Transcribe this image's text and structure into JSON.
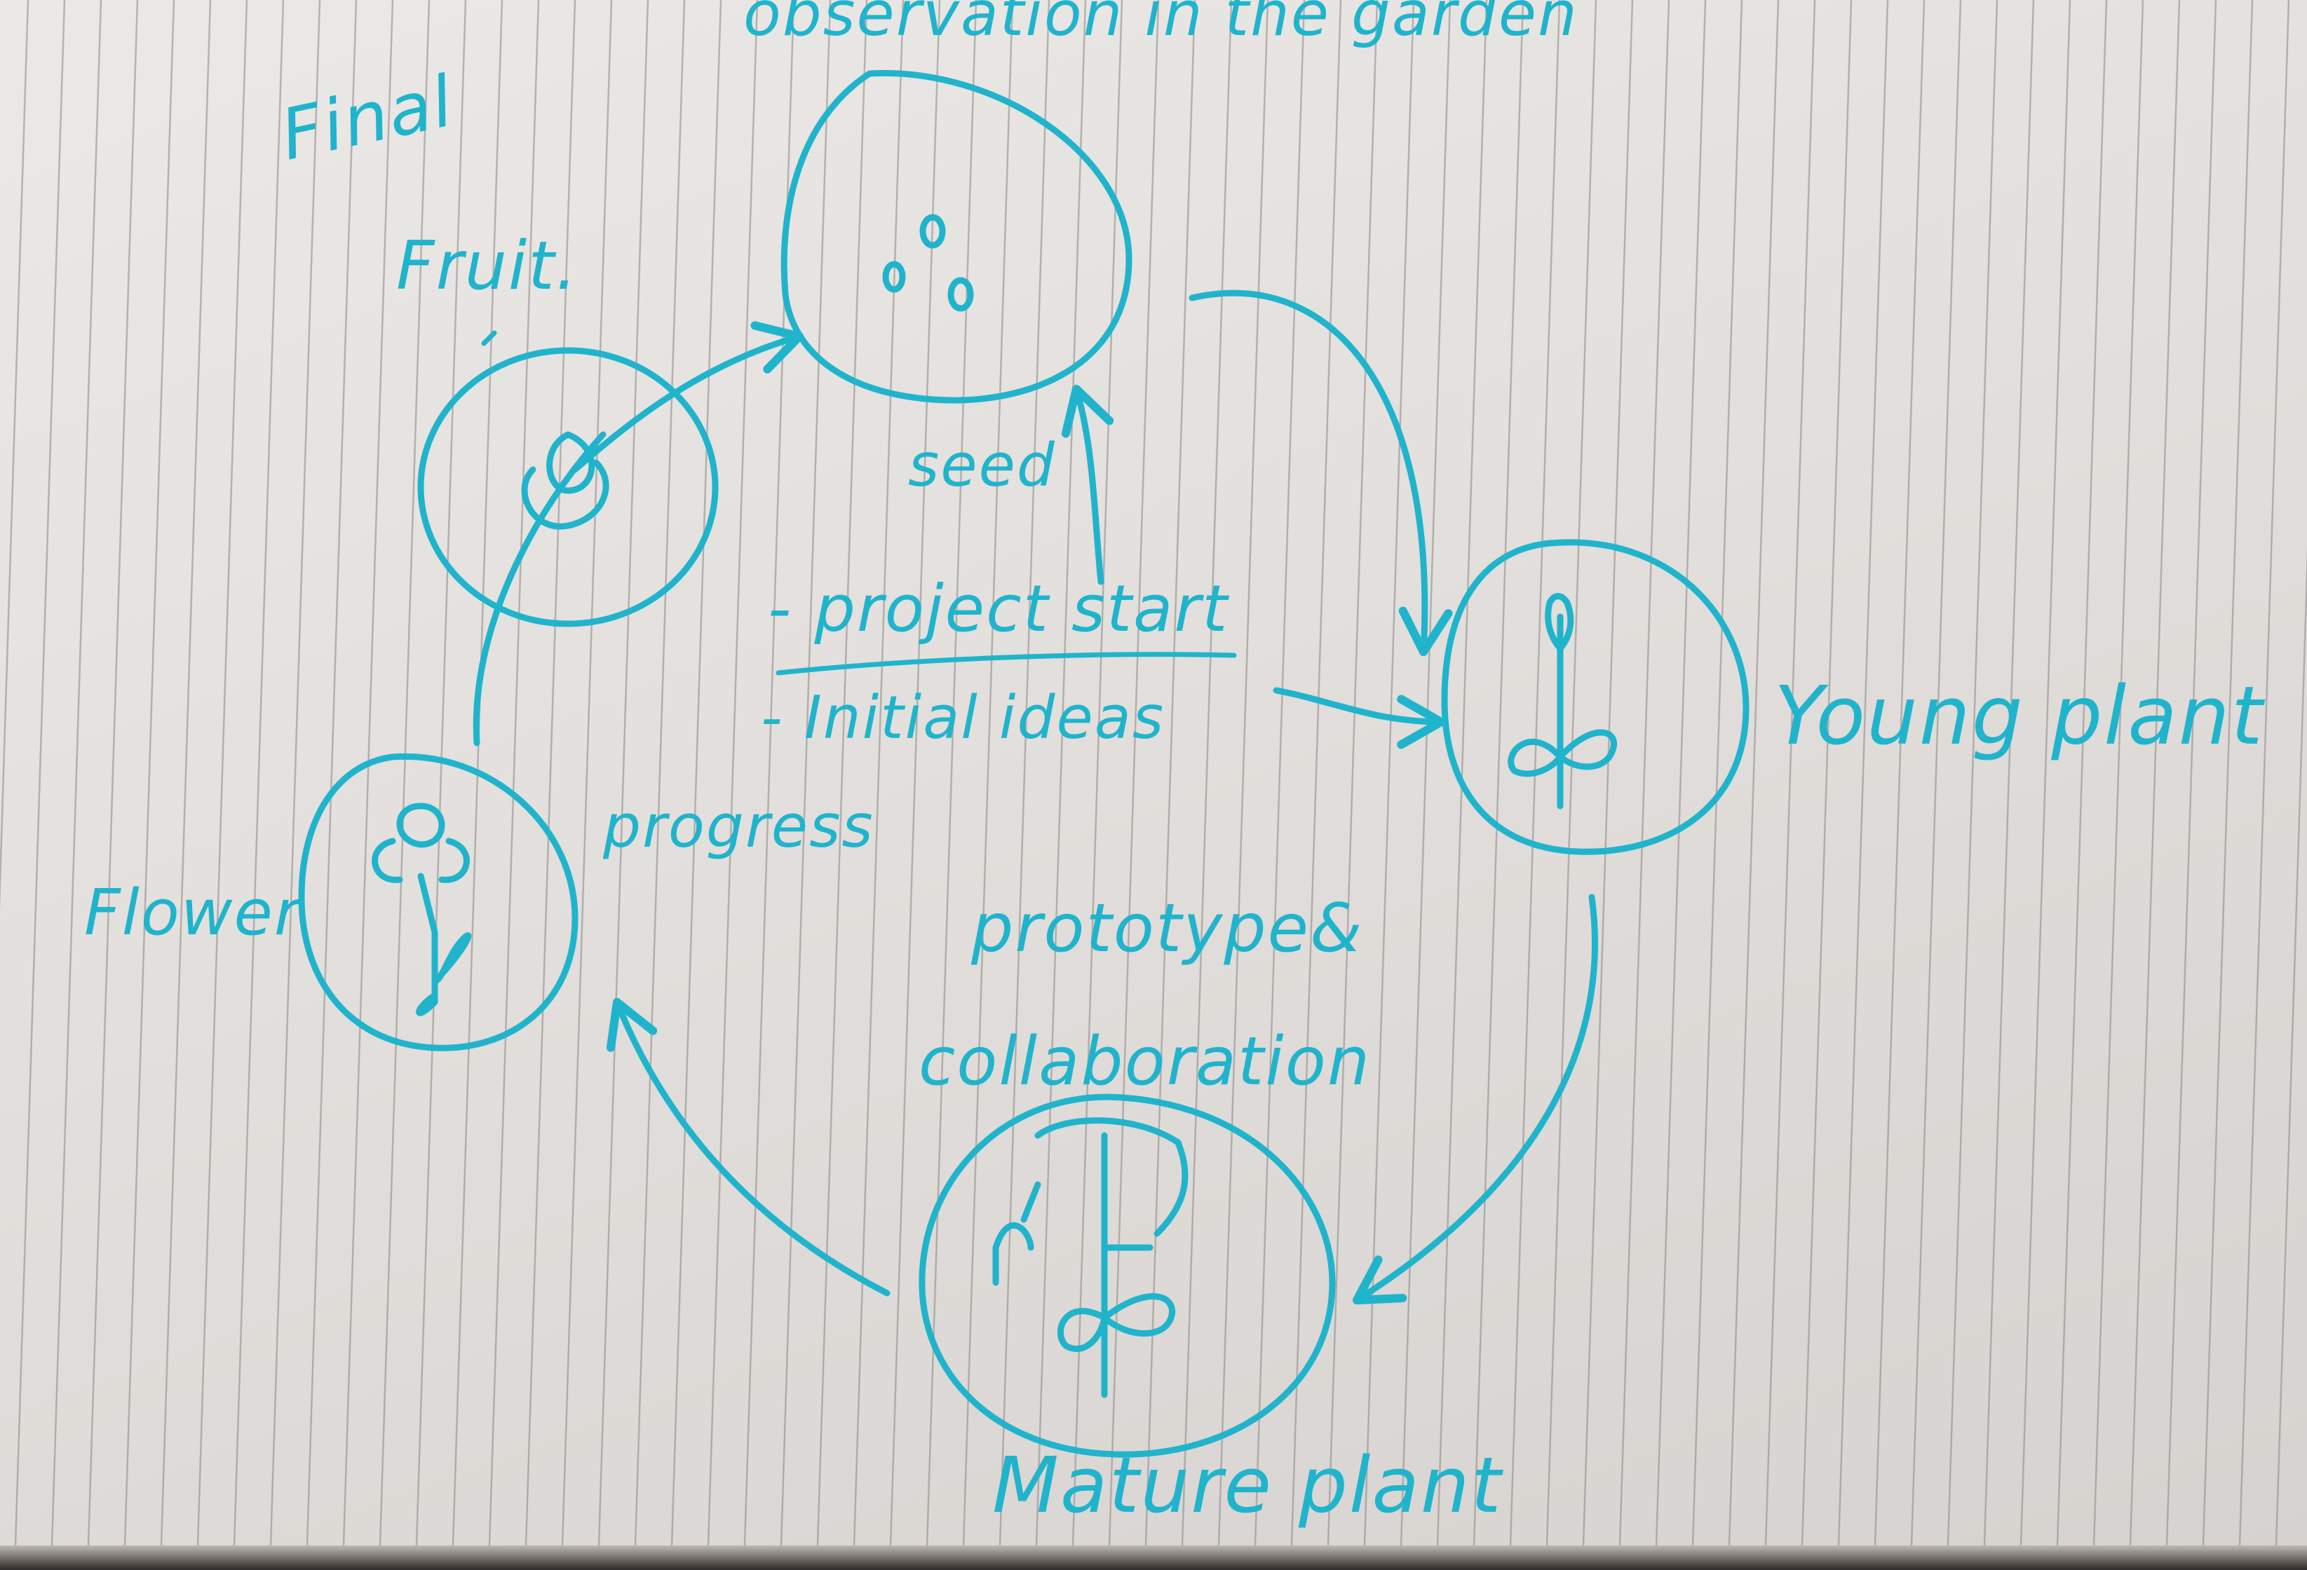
{
  "diagram": {
    "title": "observation in the garden",
    "stages": [
      {
        "id": "seed",
        "label": "seed"
      },
      {
        "id": "young",
        "label": "Young plant"
      },
      {
        "id": "mature",
        "label": "Mature plant"
      },
      {
        "id": "flower",
        "label": "Flower"
      },
      {
        "id": "fruit",
        "label": "Fruit."
      }
    ],
    "annotations": {
      "final": "Final",
      "project_start": "- project start",
      "initial_ideas": "- Initial ideas",
      "progress": "progress",
      "prototype_line1": "prototype&",
      "prototype_line2": "collaboration"
    },
    "ink_color": "#20b4cc",
    "paper_color": "#e6e3e0",
    "rule_color": "#8a8886"
  }
}
